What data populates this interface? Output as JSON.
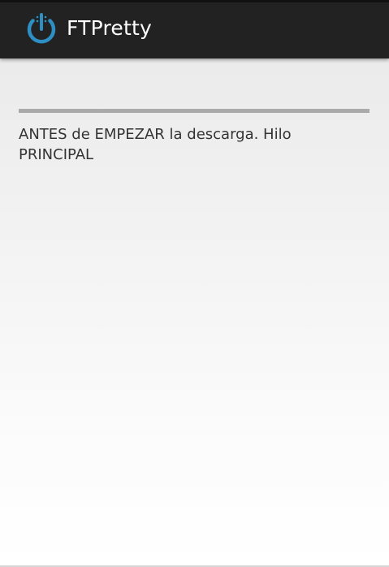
{
  "app": {
    "title": "FTPretty",
    "icon": "power-download-icon",
    "accent_color": "#33b5e5",
    "action_bar_color": "#222222"
  },
  "main": {
    "progress": 0,
    "status_text": "ANTES de EMPEZAR la descarga. Hilo PRINCIPAL"
  }
}
